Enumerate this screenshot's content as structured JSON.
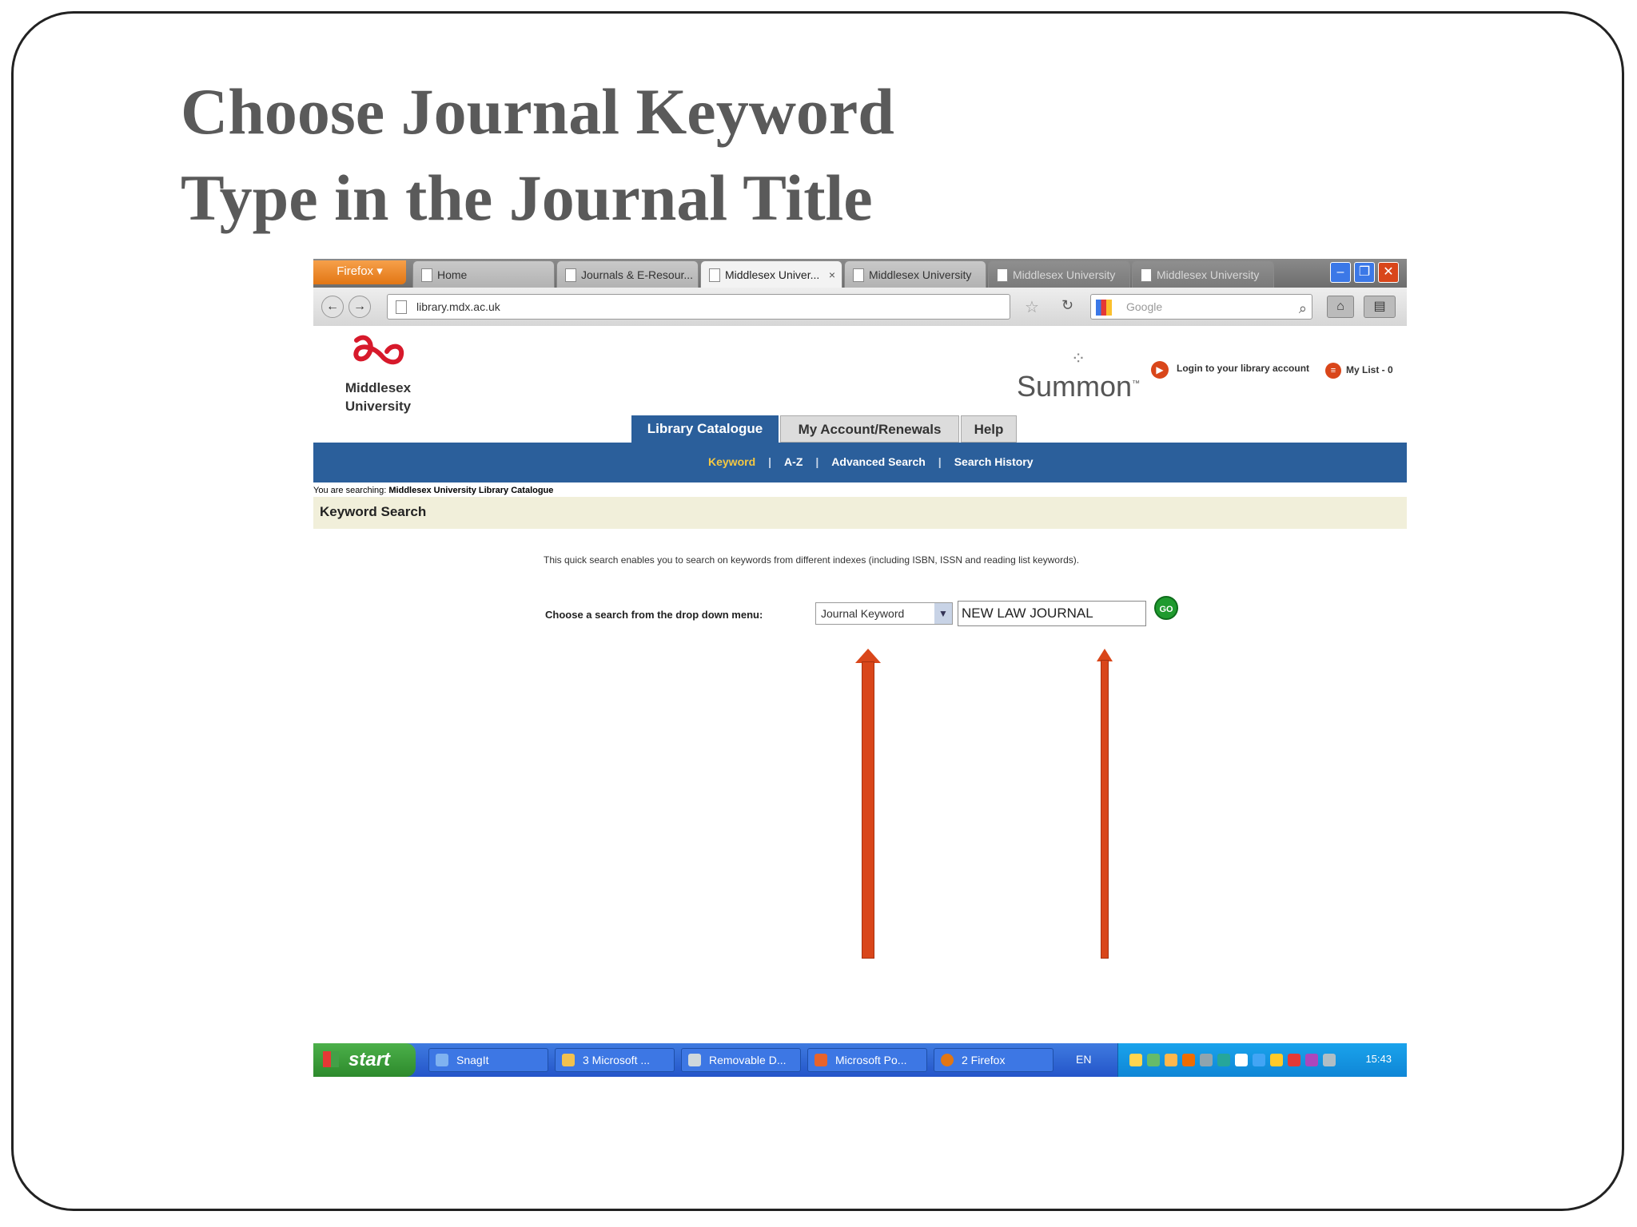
{
  "slide": {
    "title_line1": "Choose Journal Keyword",
    "title_line2": "Type in the Journal Title"
  },
  "browser": {
    "menu_button": "Firefox",
    "tabs": [
      {
        "label": "Home",
        "state": "inactive"
      },
      {
        "label": "Journals & E-Resour...",
        "state": "inactive"
      },
      {
        "label": "Middlesex Univer...",
        "state": "active"
      },
      {
        "label": "Middlesex University",
        "state": "inactive"
      },
      {
        "label": "Middlesex University",
        "state": "dim"
      },
      {
        "label": "Middlesex University",
        "state": "dim"
      }
    ],
    "url": "library.mdx.ac.uk",
    "search_placeholder": "Google"
  },
  "page": {
    "logo_text_line1": "Middlesex",
    "logo_text_line2": "University",
    "summon_text": "Summon",
    "login_link": "Login to your library account",
    "my_list_link": "My List - 0",
    "tabs": [
      {
        "label": "Library Catalogue",
        "state": "active"
      },
      {
        "label": "My Account/Renewals",
        "state": "inactive"
      },
      {
        "label": "Help",
        "state": "inactive"
      }
    ],
    "sub_nav": [
      {
        "label": "Keyword",
        "current": true
      },
      {
        "label": "A-Z",
        "current": false
      },
      {
        "label": "Advanced Search",
        "current": false
      },
      {
        "label": "Search History",
        "current": false
      }
    ],
    "searching_prefix": "You are searching:",
    "searching_target": "Middlesex University Library Catalogue",
    "heading": "Keyword Search",
    "info_text": "This quick search enables you to search on keywords from different indexes (including ISBN, ISSN and reading list keywords).",
    "choose_label": "Choose a search from the drop down menu:",
    "select_value": "Journal Keyword",
    "input_value": "NEW LAW JOURNAL",
    "go_label": "GO"
  },
  "taskbar": {
    "start_label": "start",
    "items": [
      {
        "label": "SnagIt"
      },
      {
        "label": "3 Microsoft ..."
      },
      {
        "label": "Removable D..."
      },
      {
        "label": "Microsoft Po..."
      },
      {
        "label": "2 Firefox"
      }
    ],
    "language": "EN",
    "clock": "15:43"
  },
  "colors": {
    "title_gray": "#5a5a5a",
    "nav_blue": "#2b5f9b",
    "arrow_orange": "#d9461a",
    "heading_bar": "#f1efda",
    "firefox_orange": "#e27614"
  }
}
